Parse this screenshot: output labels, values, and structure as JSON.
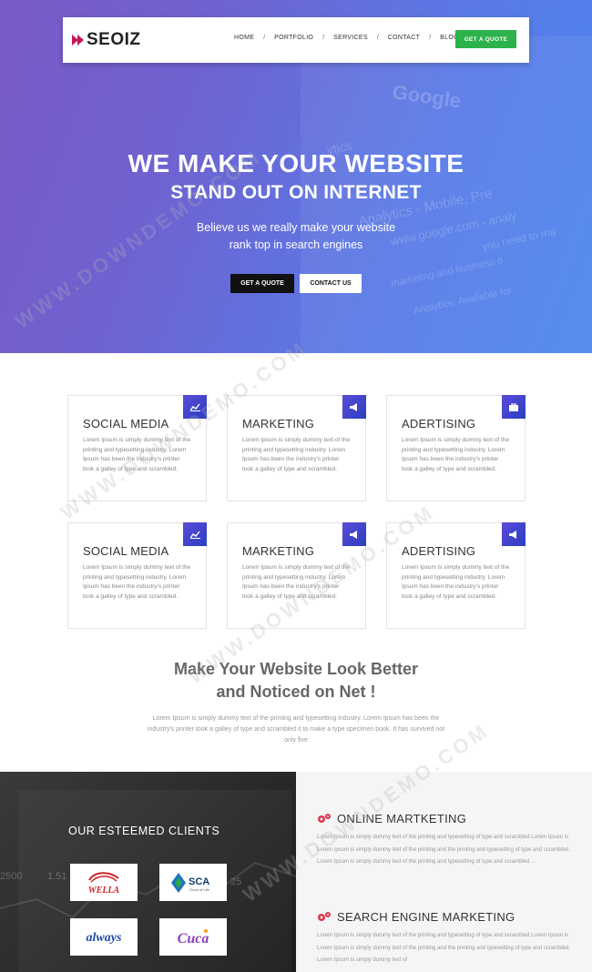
{
  "brand": {
    "logo_text": "SEOIZ"
  },
  "nav": {
    "items": [
      {
        "label": "HOME"
      },
      {
        "label": "PORTFOLIO"
      },
      {
        "label": "SERVICES"
      },
      {
        "label": "CONTACT"
      },
      {
        "label": "BLOG"
      }
    ],
    "separator": "/",
    "cta": "GET A QUOTE"
  },
  "hero": {
    "title_line1": "WE MAKE YOUR WEBSITE",
    "title_line2": "STAND OUT ON INTERNET",
    "subtitle_line1": "Believe us we really make your website",
    "subtitle_line2": "rank top in search engines",
    "btn_primary": "GET A QUOTE",
    "btn_secondary": "CONTACT US",
    "background_text": [
      "Google",
      "Analytics - Mobile, Pre",
      "www.google.com - analy",
      "you need to ma",
      "marketing and business d",
      "Analytics. Available for",
      "ytics"
    ]
  },
  "cards": [
    {
      "title": "SOCIAL MEDIA",
      "icon": "chart-icon",
      "text": "Lorem Ipsum is simply dummy text of the printing and typesetting industry. Lorem Ipsum has been the industry's printer took a galley of type and scrambled."
    },
    {
      "title": "MARKETING",
      "icon": "megaphone-icon",
      "text": "Lorem Ipsum is simply dummy text of the printing and typesetting industry. Lorem Ipsum has been the industry's printer took a galley of type and scrambled."
    },
    {
      "title": "ADERTISING",
      "icon": "briefcase-icon",
      "text": "Lorem Ipsum is simply dummy text of the printing and typesetting industry. Lorem Ipsum has been the industry's printer took a galley of type and scrambled."
    },
    {
      "title": "SOCIAL MEDIA",
      "icon": "chart-icon",
      "text": "Lorem Ipsum is simply dummy text of the printing and typesetting industry. Lorem Ipsum has been the industry's printer took a galley of type and scrambled."
    },
    {
      "title": "MARKETING",
      "icon": "megaphone-icon",
      "text": "Lorem Ipsum is simply dummy text of the printing and typesetting industry. Lorem Ipsum has been the industry's printer took a galley of type and scrambled."
    },
    {
      "title": "ADERTISING",
      "icon": "megaphone-icon",
      "text": "Lorem Ipsum is simply dummy text of the printing and typesetting industry. Lorem Ipsum has been the industry's printer took a galley of type and scrambled."
    }
  ],
  "middle": {
    "title_line1": "Make Your Website Look Better",
    "title_line2": "and Noticed on Net !",
    "text": "Lorem Ipsum is simply dummy text of the printing and typesetting industry. Lorem Ipsum has been the industry's printer took a galley of type and scrambled it to make a type specimen book. It has survived not only five"
  },
  "clients": {
    "title": "OUR ESTEEMED CLIENTS",
    "logos": [
      "WELLA",
      "SCA",
      "always",
      "Cuca"
    ],
    "sca_tagline": "Good of Life",
    "background_numbers": [
      "2500",
      "1.51",
      "25"
    ]
  },
  "services": [
    {
      "title": "ONLINE MARTKETING",
      "icon": "gears-icon",
      "text": "Lorem Ipsum is simply dummy text of the printing and typesetting of type and scrambled Lorem Ipsum is Lorem Ipsum is simply dummy text of the printing and the printing and typesetting of type and scrambled. Lorem Ipsum is simply dummy text of the printing and typesetting of type and scrambled ..."
    },
    {
      "title": "SEARCH ENGINE MARKETING",
      "icon": "gears-icon",
      "text": "Lorem Ipsum is simply dummy text of the printing and typesetting of type and scrambled Lorem Ipsum is Lorem Ipsum is simply dummy text of the printing and the printing and typesetting of type and scrambled. Lorem Ipsum is simply dummy text of"
    }
  ],
  "watermark": "WWW.DOWNDEMO.COM",
  "colors": {
    "accent_green": "#2bb24c",
    "hero_purple": "#7a5ac6",
    "hero_blue": "#4c86ee",
    "card_icon_blue": "#3a3fcc",
    "service_red": "#e0334b"
  }
}
